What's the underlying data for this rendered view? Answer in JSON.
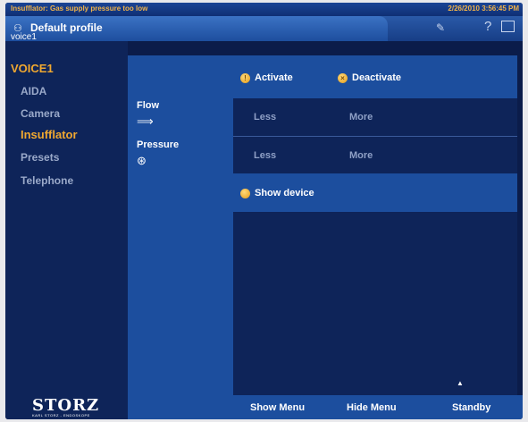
{
  "status": {
    "message": "Insufflator: Gas supply pressure too low",
    "datetime": "2/26/2010 3:56:45 PM"
  },
  "profile": {
    "name": "Default profile",
    "subtitle": "voice1"
  },
  "sidebar": {
    "title": "VOICE1",
    "items": [
      {
        "label": "AIDA",
        "active": false
      },
      {
        "label": "Camera",
        "active": false
      },
      {
        "label": "Insufflator",
        "active": true
      },
      {
        "label": "Presets",
        "active": false
      },
      {
        "label": "Telephone",
        "active": false
      }
    ]
  },
  "params": {
    "flow_label": "Flow",
    "pressure_label": "Pressure"
  },
  "controls": {
    "activate": "Activate",
    "deactivate": "Deactivate",
    "flow_less": "Less",
    "flow_more": "More",
    "pressure_less": "Less",
    "pressure_more": "More",
    "show_device": "Show device"
  },
  "bottom": {
    "show_menu": "Show Menu",
    "hide_menu": "Hide Menu",
    "standby": "Standby"
  },
  "logo": {
    "brand": "STORZ",
    "tagline": "KARL STORZ - ENDOSKOPE"
  },
  "colors": {
    "accent": "#f0a830",
    "panel": "#1c4e9e",
    "background": "#0e2459"
  }
}
